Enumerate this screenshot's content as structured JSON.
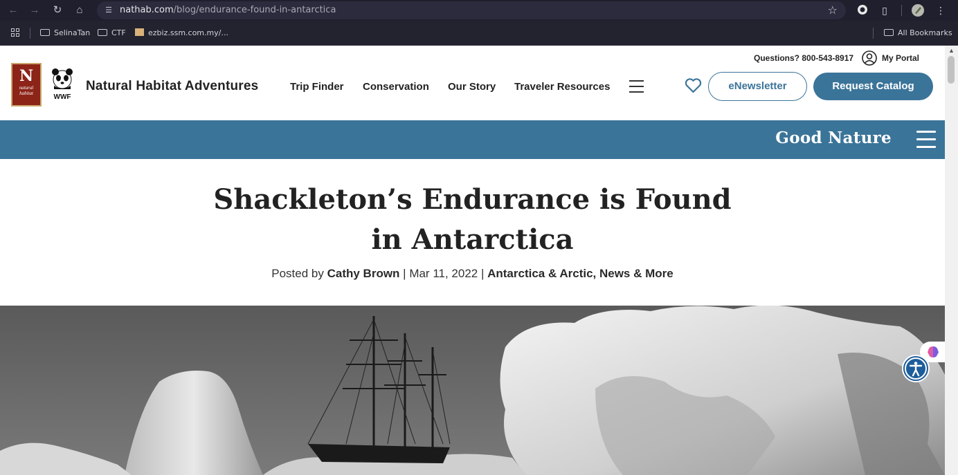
{
  "browser": {
    "url_host": "nathab.com",
    "url_path": "/blog/endurance-found-in-antarctica",
    "bookmarks": [
      {
        "label": "SelinaTan",
        "type": "folder"
      },
      {
        "label": "CTF",
        "type": "folder"
      },
      {
        "label": "ezbiz.ssm.com.my/...",
        "type": "site"
      }
    ],
    "all_bookmarks": "All Bookmarks",
    "icons": [
      "back-icon",
      "forward-icon",
      "reload-icon",
      "home-icon",
      "site-settings-icon",
      "star-icon",
      "extension-icon",
      "puzzle-icon",
      "profile-avatar",
      "menu-dots-icon"
    ]
  },
  "header": {
    "brand_name": "Natural Habitat Adventures",
    "logo_nha_initial": "N",
    "logo_nha_text": [
      "natural",
      "habitat"
    ],
    "logo_wwf_text": "WWF",
    "questions": "Questions? 800-543-8917",
    "my_portal": "My Portal",
    "nav": [
      "Trip Finder",
      "Conservation",
      "Our Story",
      "Traveler Resources"
    ],
    "enewsletter": "eNewsletter",
    "request_catalog": "Request Catalog"
  },
  "band": {
    "title": "Good Nature"
  },
  "article": {
    "headline_line1": "Shackleton’s Endurance is Found",
    "headline_line2": "in Antarctica",
    "posted_by": "Posted by",
    "author": "Cathy Brown",
    "sep1": " | ",
    "date": "Mar 11, 2022",
    "sep2": " | ",
    "categories": "Antarctica & Arctic, News & More"
  },
  "colors": {
    "brand_blue": "#3b7499",
    "nha_red": "#8c2418",
    "chrome_dark": "#1f1f2e"
  }
}
